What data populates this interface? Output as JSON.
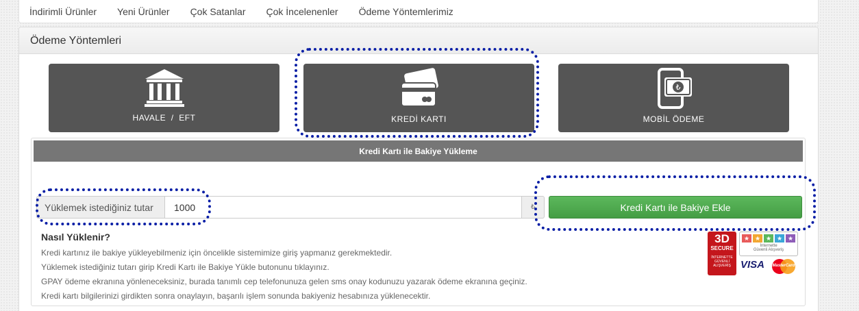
{
  "nav": {
    "items": [
      "İndirimli Ürünler",
      "Yeni Ürünler",
      "Çok Satanlar",
      "Çok İncelenenler",
      "Ödeme Yöntemlerimiz"
    ]
  },
  "panel": {
    "title": "Ödeme Yöntemleri"
  },
  "methods": [
    {
      "label": "HAVALE  /  EFT",
      "icon": "bank-icon"
    },
    {
      "label": "KREDİ KARTI",
      "icon": "credit-card-icon"
    },
    {
      "label": "MOBİL ÖDEME",
      "icon": "mobile-payment-icon"
    }
  ],
  "form": {
    "header": "Kredi Kartı ile Bakiye Yükleme",
    "amount_label": "Yüklemek istediğiniz tutar",
    "amount_value": "1000",
    "currency_symbol": "₺",
    "submit_label": "Kredi Kartı ile Bakiye Ekle"
  },
  "instructions": {
    "title": "Nasıl Yüklenir?",
    "lines": [
      "Kredi kartınız ile bakiye yükleyebilmeniz için öncelikle sistemimize giriş yapmanız gerekmektedir.",
      "Yüklemek istediğiniz tutarı girip Kredi Kartı ile Bakiye Yükle butonunu tıklayınız.",
      "GPAY ödeme ekranına yönleneceksiniz, burada tanımlı cep telefonunuza gelen sms onay kodunuzu yazarak ödeme ekranına geçiniz.",
      "Kredi kartı bilgilerinizi girdikten sonra onaylayın, başarılı işlem sonunda bakiyeniz hesabınıza yüklenecektir."
    ]
  },
  "badges": {
    "secure_3d": "3D",
    "secure_word": "SECURE",
    "secure_sub1": "İNTERNETTE",
    "secure_sub2": "GÜVENLİ",
    "secure_sub3": "ALIŞVERİŞ",
    "trust_line1": "İnternette",
    "trust_line2": "Güvenli Alışveriş",
    "visa": "VISA",
    "mastercard": "MasterCard"
  },
  "colors": {
    "method_bg": "#555555",
    "highlight": "#0a1fa6",
    "button_green": "#4cae4c"
  }
}
